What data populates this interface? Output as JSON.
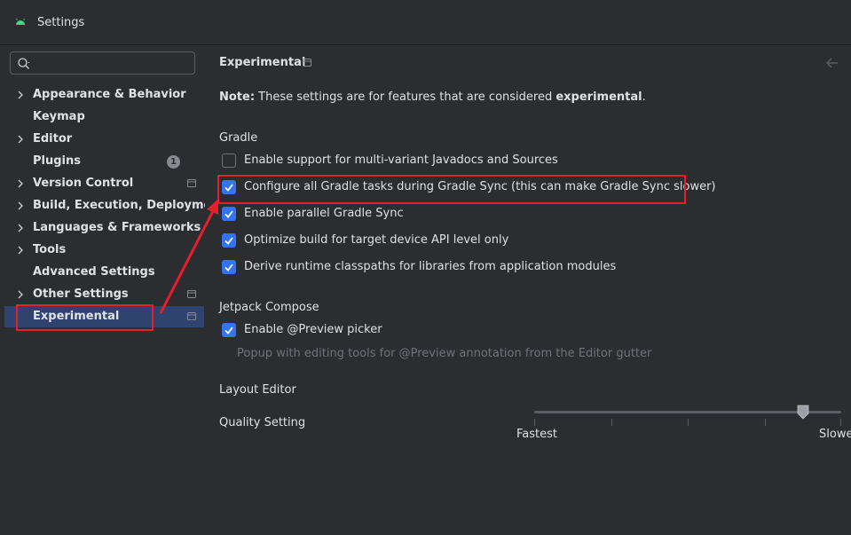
{
  "window": {
    "title": "Settings"
  },
  "search": {
    "value": "",
    "placeholder": ""
  },
  "sidebar": {
    "items": [
      {
        "label": "Appearance & Behavior",
        "expandable": true
      },
      {
        "label": "Keymap",
        "expandable": false
      },
      {
        "label": "Editor",
        "expandable": true
      },
      {
        "label": "Plugins",
        "expandable": false,
        "badge": "1"
      },
      {
        "label": "Version Control",
        "expandable": true,
        "project_icon": true
      },
      {
        "label": "Build, Execution, Deployment",
        "expandable": true
      },
      {
        "label": "Languages & Frameworks",
        "expandable": true
      },
      {
        "label": "Tools",
        "expandable": true
      },
      {
        "label": "Advanced Settings",
        "expandable": false
      },
      {
        "label": "Other Settings",
        "expandable": true,
        "project_icon": true
      },
      {
        "label": "Experimental",
        "expandable": false,
        "selected": true,
        "project_icon": true
      }
    ]
  },
  "main": {
    "title": "Experimental",
    "note_prefix": "Note:",
    "note_text": " These settings are for features that are considered ",
    "note_emphasis": "experimental",
    "note_suffix": ".",
    "gradle": {
      "label": "Gradle",
      "options": [
        {
          "label": "Enable support for multi-variant Javadocs and Sources",
          "checked": false
        },
        {
          "label": "Configure all Gradle tasks during Gradle Sync (this can make Gradle Sync slower)",
          "checked": true
        },
        {
          "label": "Enable parallel Gradle Sync",
          "checked": true
        },
        {
          "label": "Optimize build for target device API level only",
          "checked": true
        },
        {
          "label": "Derive runtime classpaths for libraries from application modules",
          "checked": true
        }
      ]
    },
    "compose": {
      "label": "Jetpack Compose",
      "options": [
        {
          "label": "Enable @Preview picker",
          "checked": true
        }
      ],
      "hint": "Popup with editing tools for @Preview annotation from the Editor gutter"
    },
    "layout_editor": {
      "label": "Layout Editor",
      "quality_label": "Quality Setting",
      "slider_min_label": "Fastest",
      "slider_max_label": "Slowest",
      "slider_value_fraction": 0.875
    }
  },
  "colors": {
    "accent": "#3574f0",
    "selection": "#2e436e",
    "annotation_red": "#e5202a",
    "background": "#2b2d30"
  },
  "icons": [
    "android-icon",
    "search-icon",
    "chevron-right-icon",
    "project-scope-icon",
    "back-arrow-icon",
    "checkmark-icon"
  ]
}
